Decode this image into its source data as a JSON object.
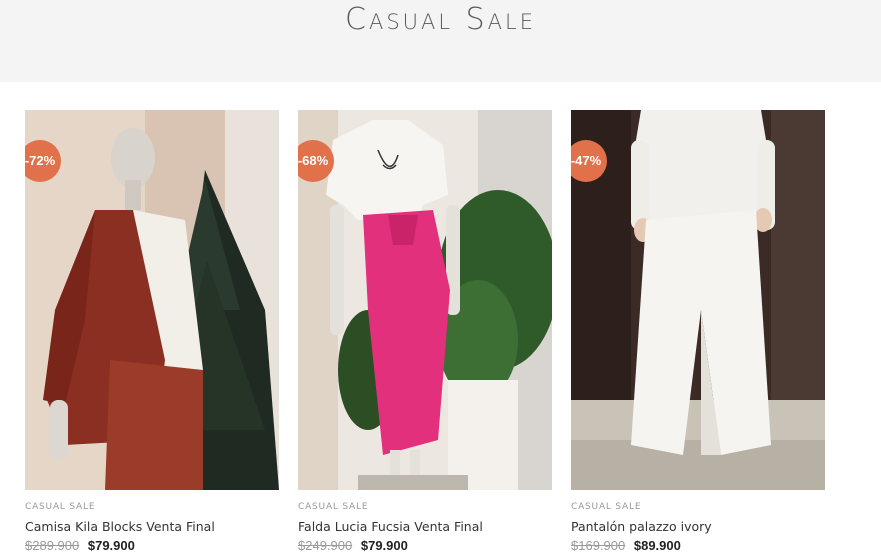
{
  "header": {
    "title": "Casual Sale"
  },
  "products": [
    {
      "badge": "-72%",
      "category": "CASUAL SALE",
      "name": "Camisa Kila Blocks Venta Final",
      "old_price": "$289.900",
      "new_price": "$79.900",
      "image_icon": "product-photo-rust-shirt-set"
    },
    {
      "badge": "-68%",
      "category": "CASUAL SALE",
      "name": "Falda Lucia Fucsia Venta Final",
      "old_price": "$249.900",
      "new_price": "$79.900",
      "image_icon": "product-photo-fuchsia-skirt"
    },
    {
      "badge": "-47%",
      "category": "CASUAL SALE",
      "name": "Pantalón palazzo ivory",
      "old_price": "$169.900",
      "new_price": "$89.900",
      "image_icon": "product-photo-ivory-palazzo"
    }
  ],
  "colors": {
    "badge": "#e0714a",
    "header_bg": "#f4f4f4"
  }
}
